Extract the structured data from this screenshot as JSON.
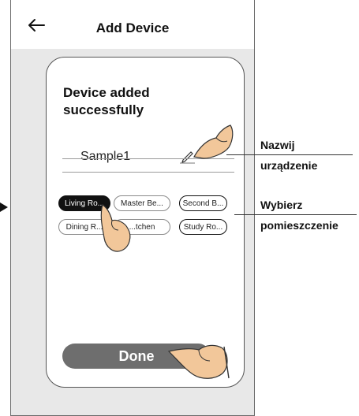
{
  "header": {
    "title": "Add Device",
    "back_icon": "arrow-left-icon"
  },
  "card": {
    "message": "Device added successfully",
    "device_name": "Sample1",
    "edit_icon": "pencil-icon",
    "rooms": [
      {
        "label": "Living Ro...",
        "selected": true
      },
      {
        "label": "Master Be...",
        "selected": false
      },
      {
        "label": "Second B...",
        "selected": false
      },
      {
        "label": "Dining R...",
        "selected": false
      },
      {
        "label": "...tchen",
        "selected": false
      },
      {
        "label": "Study Ro...",
        "selected": false
      }
    ],
    "done_label": "Done"
  },
  "annotations": {
    "rename_line1": "Nazwij",
    "rename_line2": "urządzenie",
    "room_line1": "Wybierz",
    "room_line2": "pomieszczenie"
  },
  "colors": {
    "selected_chip": "#111111",
    "done_button": "#6e6e6e",
    "background": "#e8e8e8"
  }
}
